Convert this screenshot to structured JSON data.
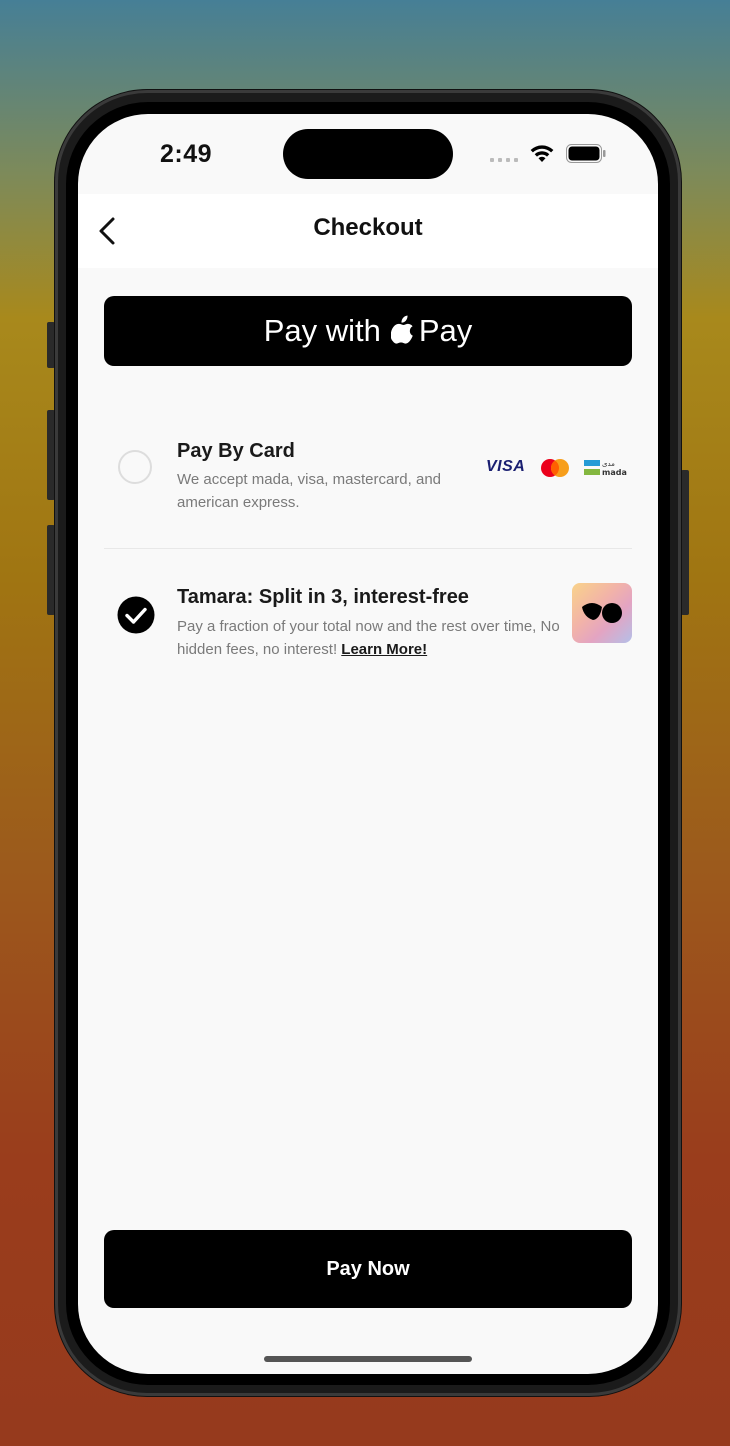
{
  "status_bar": {
    "time": "2:49"
  },
  "header": {
    "title": "Checkout"
  },
  "apple_pay": {
    "label": "Pay with",
    "brand": "Pay"
  },
  "options": [
    {
      "title": "Pay By Card",
      "description": "We accept mada, visa, mastercard, and american express.",
      "selected": false,
      "logos": [
        "visa-logo",
        "mastercard-logo",
        "mada-logo"
      ],
      "visa_text": "VISA"
    },
    {
      "title": "Tamara: Split in 3, interest-free",
      "description": "Pay a fraction of your total now and the rest over time, No hidden fees, no interest!",
      "link_text": "Learn More!",
      "selected": true,
      "logo": "tamara-logo"
    }
  ],
  "footer": {
    "pay_now_label": "Pay Now"
  },
  "colors": {
    "background": "#f9f9f9",
    "primary": "#000000",
    "muted_text": "#7a7a7a"
  }
}
